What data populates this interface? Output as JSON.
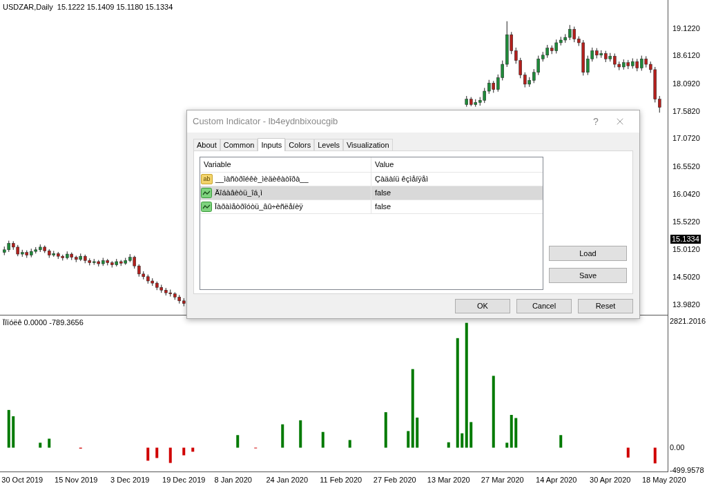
{
  "chart": {
    "header": "USDZAR,Daily  15.1222 15.1409 15.1180 15.1334",
    "current_price": "15.1334",
    "chart_data": {
      "type": "candlestick",
      "ylim": [
        13.791,
        19.645
      ],
      "categories": [
        null,
        null,
        null,
        null,
        null,
        null,
        null,
        null,
        null,
        null,
        null,
        null,
        null,
        null,
        null,
        null,
        null,
        null,
        null,
        null,
        null,
        null,
        null,
        null,
        null,
        null,
        null,
        null,
        null,
        null,
        null,
        null,
        null,
        null,
        null,
        null,
        null,
        null,
        null,
        null,
        null,
        null,
        null,
        null,
        null,
        null,
        null,
        null,
        null,
        null,
        null,
        null,
        null,
        null,
        null,
        null,
        null,
        null,
        null,
        null,
        null,
        null,
        null,
        null,
        null,
        null,
        null,
        null,
        null,
        null,
        null,
        null,
        null,
        null,
        null,
        null,
        null,
        null,
        null,
        null,
        null,
        null,
        null,
        null,
        null,
        null,
        null,
        null,
        null,
        null,
        null,
        null,
        null,
        null,
        null,
        null,
        null,
        null,
        null,
        null,
        null,
        null,
        null,
        null,
        null,
        null,
        null,
        null,
        null,
        null,
        null,
        null,
        null,
        null,
        null,
        null,
        null,
        null,
        null,
        null,
        null,
        null,
        null,
        null,
        null,
        null,
        null,
        null,
        null,
        null,
        null,
        null,
        null,
        null,
        null,
        null,
        null,
        null,
        null,
        null,
        null,
        null,
        null,
        null,
        null,
        null,
        null,
        null
      ],
      "yticks": [
        {
          "value": 19.122,
          "label": "19.1220"
        },
        {
          "value": 18.612,
          "label": "18.6120"
        },
        {
          "value": 18.092,
          "label": "18.0920"
        },
        {
          "value": 17.582,
          "label": "17.5820"
        },
        {
          "value": 17.072,
          "label": "17.0720"
        },
        {
          "value": 16.552,
          "label": "16.5520"
        },
        {
          "value": 16.042,
          "label": "16.0420"
        },
        {
          "value": 15.522,
          "label": "15.5220"
        },
        {
          "value": 15.012,
          "label": "15.0120"
        },
        {
          "value": 14.502,
          "label": "14.5020"
        },
        {
          "value": 13.982,
          "label": "13.9820"
        }
      ],
      "ohlc": [
        [
          14.95,
          15.06,
          14.9,
          15.0
        ],
        [
          15.0,
          15.17,
          14.96,
          15.12
        ],
        [
          15.12,
          15.16,
          15.0,
          15.05
        ],
        [
          15.05,
          15.09,
          14.88,
          14.92
        ],
        [
          14.92,
          15.0,
          14.87,
          14.95
        ],
        [
          14.95,
          14.99,
          14.85,
          14.9
        ],
        [
          14.9,
          15.02,
          14.86,
          14.97
        ],
        [
          14.97,
          15.05,
          14.93,
          15.0
        ],
        [
          15.0,
          15.1,
          14.96,
          15.05
        ],
        [
          15.05,
          15.08,
          14.94,
          14.98
        ],
        [
          14.98,
          15.01,
          14.85,
          14.9
        ],
        [
          14.9,
          14.98,
          14.87,
          14.93
        ],
        [
          14.93,
          14.96,
          14.83,
          14.88
        ],
        [
          14.88,
          14.91,
          14.8,
          14.85
        ],
        [
          14.85,
          14.97,
          14.82,
          14.92
        ],
        [
          14.92,
          14.95,
          14.81,
          14.86
        ],
        [
          14.86,
          14.89,
          14.77,
          14.82
        ],
        [
          14.82,
          14.93,
          14.79,
          14.88
        ],
        [
          14.88,
          14.91,
          14.75,
          14.8
        ],
        [
          14.8,
          14.84,
          14.71,
          14.76
        ],
        [
          14.76,
          14.83,
          14.72,
          14.78
        ],
        [
          14.78,
          14.81,
          14.69,
          14.74
        ],
        [
          14.74,
          14.85,
          14.7,
          14.8
        ],
        [
          14.8,
          14.83,
          14.71,
          14.76
        ],
        [
          14.76,
          14.79,
          14.67,
          14.72
        ],
        [
          14.72,
          14.83,
          14.69,
          14.78
        ],
        [
          14.78,
          14.81,
          14.7,
          14.75
        ],
        [
          14.75,
          14.85,
          14.72,
          14.8
        ],
        [
          14.8,
          14.92,
          14.77,
          14.86
        ],
        [
          14.86,
          14.89,
          14.65,
          14.7
        ],
        [
          14.7,
          14.73,
          14.5,
          14.55
        ],
        [
          14.55,
          14.6,
          14.45,
          14.5
        ],
        [
          14.5,
          14.54,
          14.37,
          14.42
        ],
        [
          14.42,
          14.47,
          14.33,
          14.38
        ],
        [
          14.38,
          14.41,
          14.25,
          14.3
        ],
        [
          14.3,
          14.35,
          14.2,
          14.25
        ],
        [
          14.25,
          14.29,
          14.15,
          14.2
        ],
        [
          14.2,
          14.26,
          14.13,
          14.18
        ],
        [
          14.18,
          14.21,
          14.07,
          14.12
        ],
        [
          14.12,
          14.16,
          14.0,
          14.05
        ],
        [
          14.05,
          14.1,
          13.95,
          14.0
        ],
        null,
        null,
        null,
        null,
        null,
        null,
        null,
        null,
        null,
        null,
        null,
        null,
        null,
        null,
        null,
        null,
        null,
        null,
        null,
        null,
        null,
        null,
        null,
        null,
        null,
        null,
        null,
        null,
        null,
        null,
        null,
        null,
        null,
        null,
        null,
        null,
        null,
        null,
        null,
        null,
        null,
        null,
        null,
        null,
        null,
        null,
        null,
        null,
        null,
        null,
        null,
        null,
        null,
        null,
        null,
        null,
        null,
        null,
        null,
        null,
        null,
        null,
        [
          17.7,
          17.86,
          17.66,
          17.8
        ],
        [
          17.8,
          17.84,
          17.67,
          17.7
        ],
        [
          17.7,
          17.8,
          17.66,
          17.74
        ],
        [
          17.74,
          17.84,
          17.68,
          17.78
        ],
        [
          17.78,
          18.01,
          17.73,
          17.95
        ],
        [
          17.95,
          18.16,
          17.9,
          18.1
        ],
        [
          18.1,
          18.14,
          17.92,
          17.98
        ],
        [
          17.98,
          18.26,
          17.94,
          18.2
        ],
        [
          18.2,
          18.52,
          18.15,
          18.45
        ],
        [
          18.45,
          19.25,
          18.4,
          19.0
        ],
        [
          19.0,
          19.05,
          18.64,
          18.7
        ],
        [
          18.7,
          18.76,
          18.46,
          18.52
        ],
        [
          18.52,
          18.57,
          18.19,
          18.25
        ],
        [
          18.25,
          18.3,
          18.02,
          18.08
        ],
        [
          18.08,
          18.21,
          18.03,
          18.15
        ],
        [
          18.15,
          18.36,
          18.1,
          18.3
        ],
        [
          18.3,
          18.61,
          18.25,
          18.55
        ],
        [
          18.55,
          18.68,
          18.5,
          18.62
        ],
        [
          18.62,
          18.81,
          18.57,
          18.75
        ],
        [
          18.75,
          18.8,
          18.64,
          18.7
        ],
        [
          18.7,
          18.91,
          18.65,
          18.85
        ],
        [
          18.85,
          18.96,
          18.8,
          18.9
        ],
        [
          18.9,
          19.01,
          18.85,
          18.95
        ],
        [
          18.95,
          19.18,
          18.9,
          19.1
        ],
        [
          19.1,
          19.15,
          18.86,
          18.92
        ],
        [
          18.92,
          18.97,
          18.79,
          18.85
        ],
        [
          18.85,
          18.9,
          18.24,
          18.3
        ],
        [
          18.3,
          18.61,
          18.25,
          18.55
        ],
        [
          18.55,
          18.76,
          18.5,
          18.7
        ],
        [
          18.7,
          18.75,
          18.56,
          18.62
        ],
        [
          18.62,
          18.71,
          18.57,
          18.65
        ],
        [
          18.65,
          18.7,
          18.49,
          18.55
        ],
        [
          18.55,
          18.66,
          18.5,
          18.6
        ],
        [
          18.6,
          18.65,
          18.39,
          18.45
        ],
        [
          18.45,
          18.5,
          18.34,
          18.4
        ],
        [
          18.4,
          18.54,
          18.35,
          18.48
        ],
        [
          18.48,
          18.53,
          18.36,
          18.42
        ],
        [
          18.42,
          18.56,
          18.37,
          18.5
        ],
        [
          18.5,
          18.55,
          18.32,
          18.38
        ],
        [
          18.38,
          18.61,
          18.33,
          18.55
        ],
        [
          18.55,
          18.6,
          18.39,
          18.45
        ],
        [
          18.45,
          18.5,
          18.29,
          18.35
        ],
        [
          18.35,
          18.4,
          17.74,
          17.8
        ],
        [
          17.8,
          17.86,
          17.55,
          17.65
        ],
        null
      ]
    }
  },
  "indicator": {
    "label": "Ïîïóëê 0.0000 -789.3656",
    "chart_data": {
      "type": "bar",
      "ylim": [
        -499.9578,
        2821.2016
      ],
      "categories": [
        null,
        null,
        null,
        null,
        "30 Oct 2019",
        null,
        null,
        null,
        null,
        null,
        null,
        null,
        null,
        null,
        null,
        null,
        "15 Nov 2019",
        null,
        null,
        null,
        null,
        null,
        null,
        null,
        null,
        null,
        null,
        null,
        "3 Dec 2019",
        null,
        null,
        null,
        null,
        null,
        null,
        null,
        null,
        null,
        null,
        null,
        "19 Dec 2019",
        null,
        null,
        null,
        null,
        null,
        null,
        null,
        null,
        null,
        null,
        "8 Jan 2020",
        null,
        null,
        null,
        null,
        null,
        null,
        null,
        null,
        null,
        null,
        null,
        "24 Jan 2020",
        null,
        null,
        null,
        null,
        null,
        null,
        null,
        null,
        null,
        null,
        null,
        "11 Feb 2020",
        null,
        null,
        null,
        null,
        null,
        null,
        null,
        null,
        null,
        null,
        null,
        "27 Feb 2020",
        null,
        null,
        null,
        null,
        null,
        null,
        null,
        null,
        null,
        null,
        null,
        "13 Mar 2020",
        null,
        null,
        null,
        null,
        null,
        null,
        null,
        null,
        null,
        null,
        null,
        "27 Mar 2020",
        null,
        null,
        null,
        null,
        null,
        null,
        null,
        null,
        null,
        null,
        null,
        "14 Apr 2020",
        null,
        null,
        null,
        null,
        null,
        null,
        null,
        null,
        null,
        null,
        null,
        "30 Apr 2020",
        null,
        null,
        null,
        null,
        null,
        null,
        null,
        null,
        null,
        null,
        null,
        "18 May 2020"
      ],
      "yticks": [
        {
          "value": 2821.2016,
          "label": "2821.2016"
        },
        {
          "value": 0,
          "label": "0.00"
        },
        {
          "value": -499.9578,
          "label": "-499.9578"
        }
      ],
      "series": [
        {
          "values": [
            null,
            840,
            700,
            null,
            null,
            null,
            null,
            null,
            110,
            null,
            200,
            null,
            null,
            null,
            null,
            null,
            null,
            -20,
            null,
            null,
            null,
            null,
            null,
            null,
            null,
            null,
            null,
            null,
            null,
            null,
            null,
            null,
            -290,
            null,
            -230,
            null,
            null,
            -340,
            null,
            null,
            -170,
            null,
            -90,
            null,
            null,
            null,
            null,
            null,
            null,
            null,
            null,
            null,
            280,
            null,
            null,
            null,
            -10,
            null,
            null,
            null,
            null,
            null,
            520,
            null,
            null,
            null,
            610,
            null,
            null,
            null,
            null,
            350,
            null,
            null,
            null,
            null,
            null,
            170,
            null,
            null,
            null,
            null,
            null,
            null,
            null,
            790,
            null,
            null,
            null,
            null,
            370,
            1750,
            670,
            null,
            null,
            null,
            null,
            null,
            null,
            120,
            null,
            2440,
            320,
            2780,
            570,
            null,
            null,
            null,
            null,
            1600,
            null,
            null,
            110,
            730,
            660,
            null,
            null,
            null,
            null,
            null,
            null,
            null,
            null,
            null,
            280,
            null,
            null,
            null,
            null,
            null,
            null,
            null,
            null,
            null,
            null,
            null,
            null,
            null,
            null,
            -220,
            null,
            null,
            null,
            null,
            null,
            -350,
            null,
            null
          ]
        }
      ]
    }
  },
  "dialog": {
    "title": "Custom Indicator - lb4eydnbixoucgib",
    "help": "?",
    "tabs": [
      {
        "label": "About",
        "selected": false
      },
      {
        "label": "Common",
        "selected": false
      },
      {
        "label": "Inputs",
        "selected": true
      },
      {
        "label": "Colors",
        "selected": false
      },
      {
        "label": "Levels",
        "selected": false
      },
      {
        "label": "Visualization",
        "selected": false
      }
    ],
    "columns": [
      "Variable",
      "Value"
    ],
    "rows": [
      {
        "kind": "string",
        "icon_label": "ab",
        "variable": "__ìàñòðîéêè_ìèäèêàòîðà__",
        "value": "Çàäàíü êçìåíÿåì",
        "selected": false
      },
      {
        "kind": "bool",
        "variable": "Äîáàâèòü_îá¸ì",
        "value": "false",
        "selected": true
      },
      {
        "kind": "bool",
        "variable": "Ïàðàìåòðîóòü_âû÷èñëåíèÿ",
        "value": "false",
        "selected": false
      }
    ],
    "side_buttons": [
      "Load",
      "Save"
    ],
    "buttons": [
      "OK",
      "Cancel",
      "Reset"
    ]
  }
}
